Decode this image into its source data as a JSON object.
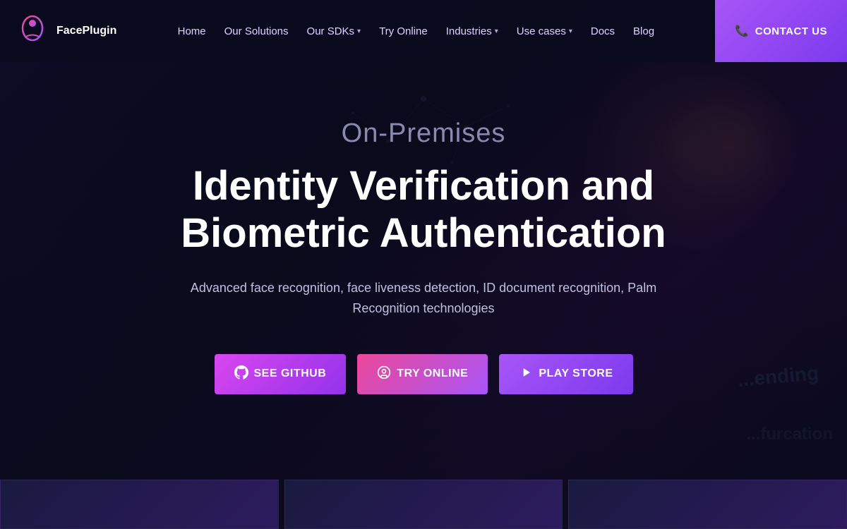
{
  "brand": {
    "name": "FacePlugin",
    "logo_alt": "FacePlugin logo"
  },
  "nav": {
    "items": [
      {
        "label": "Home",
        "has_dropdown": false
      },
      {
        "label": "Our Solutions",
        "has_dropdown": false
      },
      {
        "label": "Our SDKs",
        "has_dropdown": true
      },
      {
        "label": "Try Online",
        "has_dropdown": false
      },
      {
        "label": "Industries",
        "has_dropdown": true
      },
      {
        "label": "Use cases",
        "has_dropdown": true
      },
      {
        "label": "Docs",
        "has_dropdown": false
      },
      {
        "label": "Blog",
        "has_dropdown": false
      }
    ],
    "contact_button": "CONTACT US",
    "contact_icon": "📞"
  },
  "hero": {
    "subtitle": "On-Premises",
    "title": "Identity Verification and Biometric Authentication",
    "description": "Advanced face recognition, face liveness detection, ID document recognition, Palm Recognition technologies"
  },
  "cta_buttons": {
    "github": {
      "label": "SEE GITHUB",
      "icon": "github-icon"
    },
    "try_online": {
      "label": "TRY ONLINE",
      "icon": "try-online-icon"
    },
    "play_store": {
      "label": "Play Store",
      "icon": "play-icon"
    }
  },
  "colors": {
    "brand_purple": "#a855f7",
    "brand_pink": "#ec4899",
    "dark_bg": "#0a0a1a",
    "nav_text": "#e0d0ff"
  }
}
